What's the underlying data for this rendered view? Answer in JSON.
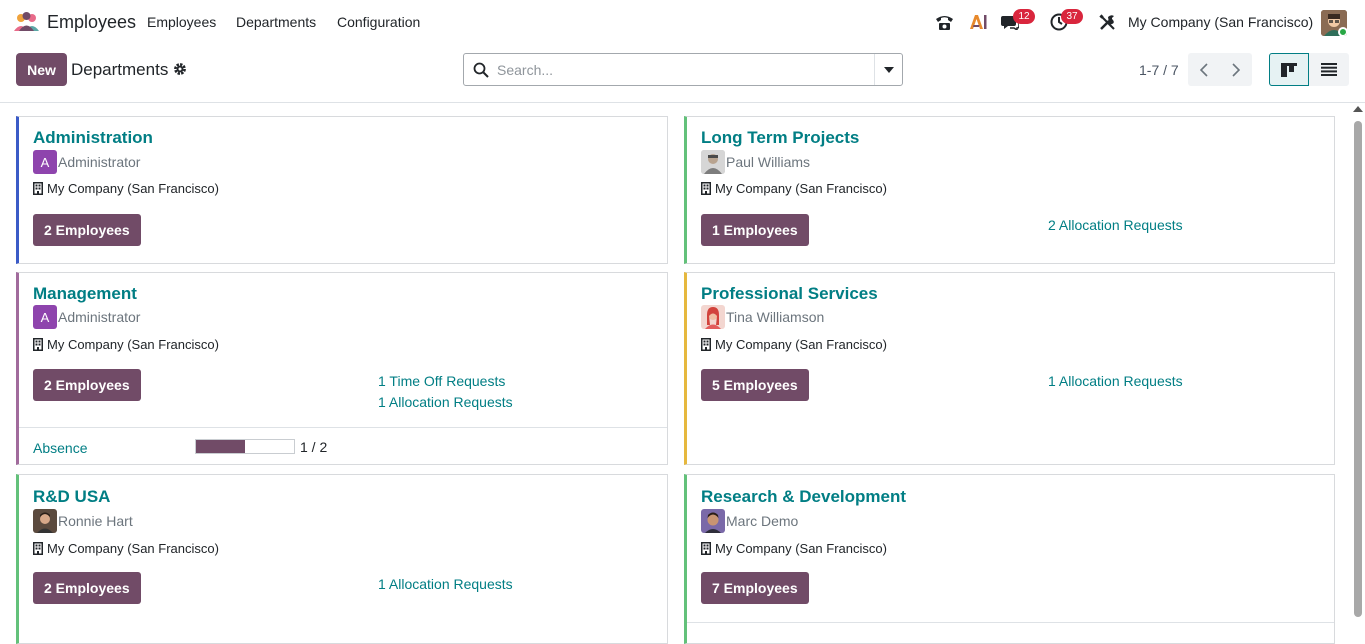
{
  "navbar": {
    "app_name": "Employees",
    "menu": [
      "Employees",
      "Departments",
      "Configuration"
    ],
    "badges": {
      "messages": "12",
      "activities": "37"
    },
    "company": "My Company (San Francisco)"
  },
  "control_panel": {
    "new_label": "New",
    "title": "Departments",
    "search_placeholder": "Search...",
    "pager": "1-7 / 7"
  },
  "colors": {
    "primary": "#714b67",
    "link": "#017e84"
  },
  "departments": [
    {
      "name": "Administration",
      "manager": "Administrator",
      "avatar_letter": "A",
      "company": "My Company (San Francisco)",
      "employees": "2 Employees",
      "requests": [],
      "color": "#3b5bc7"
    },
    {
      "name": "Long Term Projects",
      "manager": "Paul Williams",
      "company": "My Company (San Francisco)",
      "employees": "1 Employees",
      "requests": [
        "2 Allocation Requests"
      ],
      "color": "#63c17a"
    },
    {
      "name": "Management",
      "manager": "Administrator",
      "avatar_letter": "A",
      "company": "My Company (San Francisco)",
      "employees": "2 Employees",
      "requests": [
        "1 Time Off Requests",
        "1 Allocation Requests"
      ],
      "absence_label": "Absence",
      "absence_value": "1 / 2",
      "absence_fraction": 0.5,
      "color": "#a16b9c"
    },
    {
      "name": "Professional Services",
      "manager": "Tina Williamson",
      "company": "My Company (San Francisco)",
      "employees": "5 Employees",
      "requests": [
        "1 Allocation Requests"
      ],
      "color": "#e6b83e"
    },
    {
      "name": "R&D USA",
      "manager": "Ronnie Hart",
      "company": "My Company (San Francisco)",
      "employees": "2 Employees",
      "requests": [
        "1 Allocation Requests"
      ],
      "color": "#63c17a"
    },
    {
      "name": "Research & Development",
      "manager": "Marc Demo",
      "company": "My Company (San Francisco)",
      "employees": "7 Employees",
      "requests": [],
      "color": "#63c17a"
    }
  ]
}
